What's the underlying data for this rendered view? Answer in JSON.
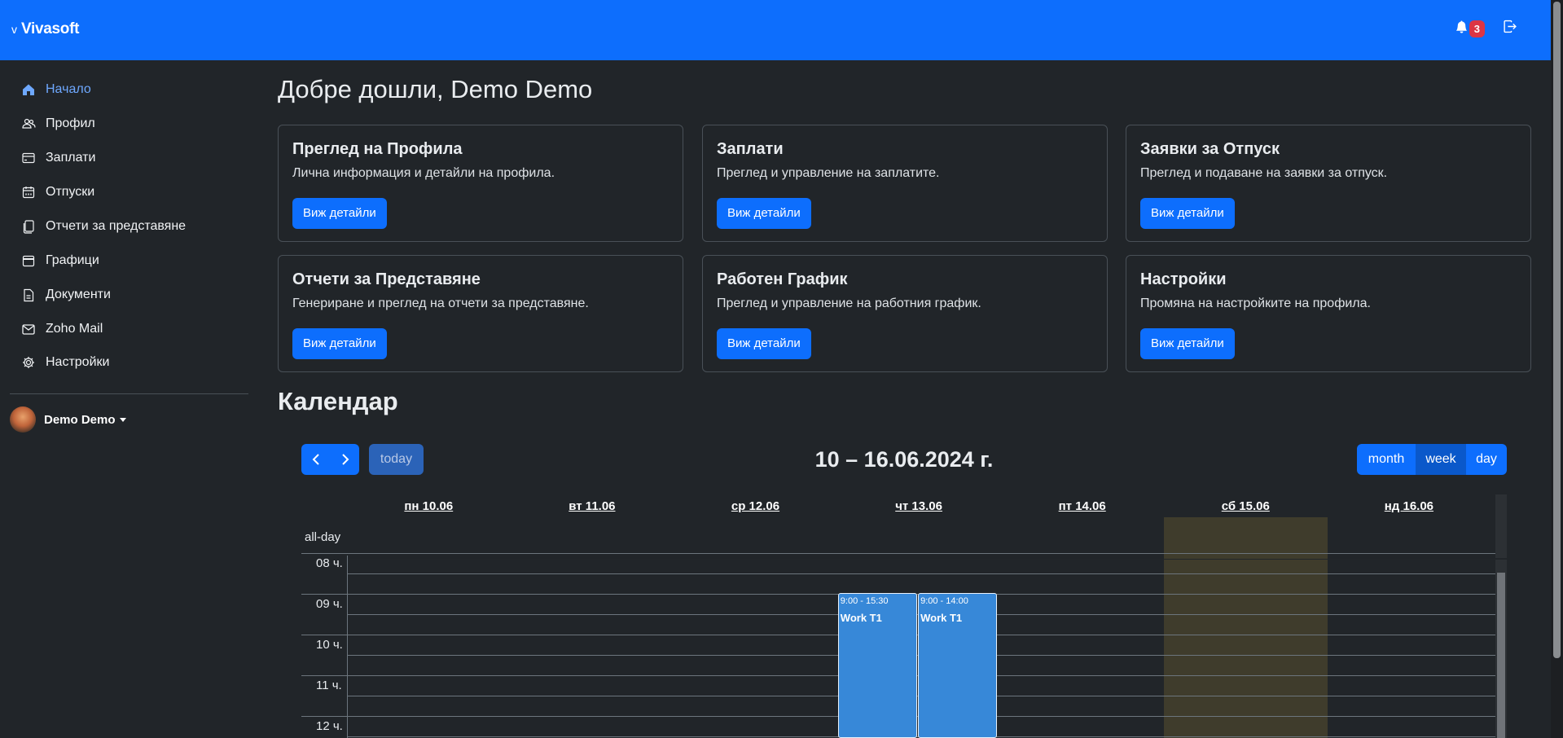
{
  "app": {
    "brand_mark": "v",
    "brand_name": "Vivasoft"
  },
  "header": {
    "notification_count": "3"
  },
  "sidebar": {
    "items": [
      {
        "label": "Начало",
        "icon": "home-icon"
      },
      {
        "label": "Профил",
        "icon": "people-icon"
      },
      {
        "label": "Заплати",
        "icon": "credit-card-icon"
      },
      {
        "label": "Отпуски",
        "icon": "calendar-week-icon"
      },
      {
        "label": "Отчети за представяне",
        "icon": "report-icon"
      },
      {
        "label": "Графици",
        "icon": "calendar-icon"
      },
      {
        "label": "Документи",
        "icon": "document-icon"
      },
      {
        "label": "Zoho Mail",
        "icon": "envelope-icon"
      },
      {
        "label": "Настройки",
        "icon": "gear-icon"
      }
    ],
    "user_name": "Demo Demo"
  },
  "main": {
    "welcome": "Добре дошли, Demo Demo",
    "cards": [
      {
        "title": "Преглед на Профила",
        "text": "Лична информация и детайли на профила.",
        "button": "Виж детайли"
      },
      {
        "title": "Заплати",
        "text": "Преглед и управление на заплатите.",
        "button": "Виж детайли"
      },
      {
        "title": "Заявки за Отпуск",
        "text": "Преглед и подаване на заявки за отпуск.",
        "button": "Виж детайли"
      },
      {
        "title": "Отчети за Представяне",
        "text": "Генериране и преглед на отчети за представяне.",
        "button": "Виж детайли"
      },
      {
        "title": "Работен График",
        "text": "Преглед и управление на работния график.",
        "button": "Виж детайли"
      },
      {
        "title": "Настройки",
        "text": "Промяна на настройките на профила.",
        "button": "Виж детайли"
      }
    ],
    "calendar_heading": "Календар"
  },
  "calendar": {
    "today_label": "today",
    "range_title": "10 – 16.06.2024 г.",
    "views": {
      "month": "month",
      "week": "week",
      "day": "day"
    },
    "active_view": "week",
    "days": [
      "пн 10.06",
      "вт 11.06",
      "ср 12.06",
      "чт 13.06",
      "пт 14.06",
      "сб 15.06",
      "нд 16.06"
    ],
    "weekend_days": [
      "сб 15.06"
    ],
    "allday_label": "all-day",
    "hours": [
      "08 ч.",
      "09 ч.",
      "10 ч.",
      "11 ч.",
      "12 ч."
    ],
    "events": [
      {
        "day": "чт 13.06",
        "time": "9:00 - 15:30",
        "title": "Work T1",
        "start": "9:00",
        "end": "15:30"
      },
      {
        "day": "чт 13.06",
        "time": "9:00 - 14:00",
        "title": "Work T1",
        "start": "9:00",
        "end": "14:00"
      }
    ],
    "event_color": "#3788d8",
    "weekend_color": "#3f3c2c"
  }
}
